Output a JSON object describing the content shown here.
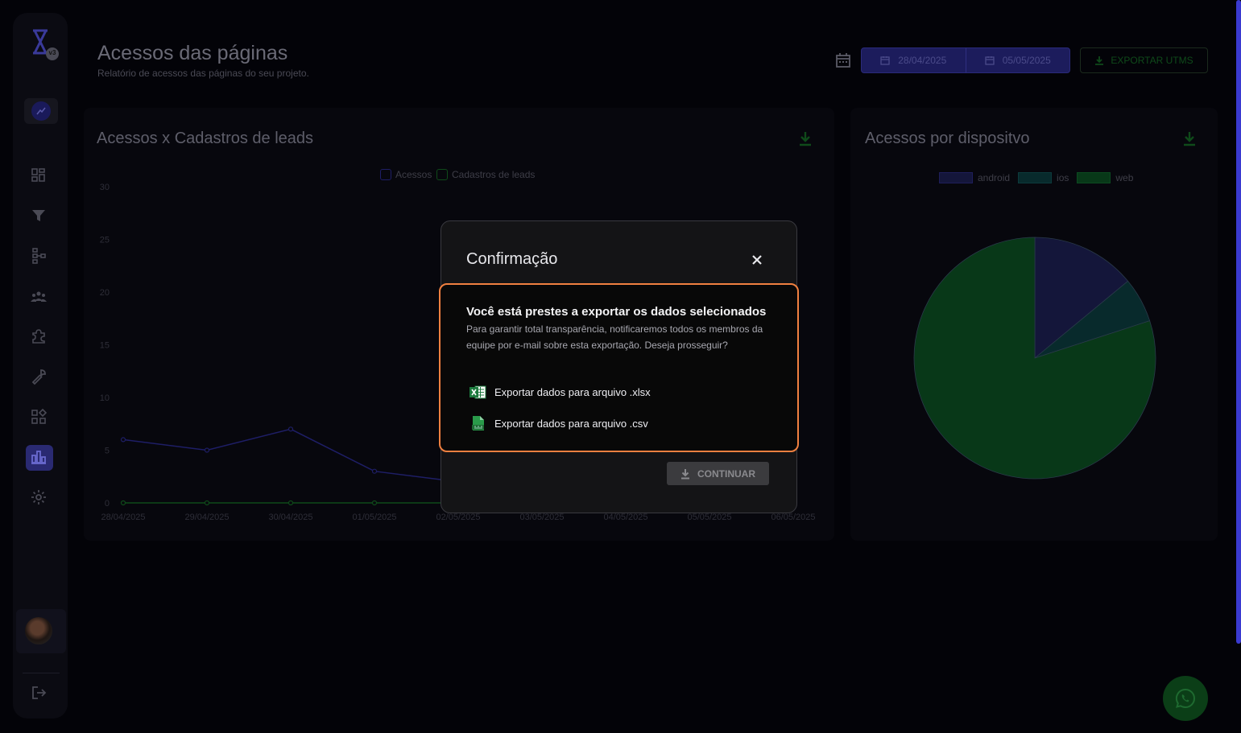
{
  "header": {
    "title": "Acessos das páginas",
    "subtitle": "Relatório de acessos das páginas do seu projeto.",
    "date_start": "28/04/2025",
    "date_end": "05/05/2025",
    "export_utms_label": "EXPORTAR UTMS"
  },
  "sidebar": {
    "brand_badge": "v3",
    "items": [
      "dashboard-icon",
      "funnel-icon",
      "flow-icon",
      "team-icon",
      "puzzle-icon",
      "wrench-icon",
      "apps-icon",
      "chart-icon",
      "gear-icon"
    ],
    "active_item": "chart-icon"
  },
  "colors": {
    "accent": "#2a2a72",
    "highlight_border": "#f08040",
    "acessos_line": "#1e1e66",
    "cadastros_line": "#0f4a1a",
    "android": "#14163a",
    "ios": "#082a2c",
    "web": "#083818"
  },
  "chart_data": [
    {
      "type": "line",
      "title": "Acessos x Cadastros de leads",
      "x": [
        "28/04/2025",
        "29/04/2025",
        "30/04/2025",
        "01/05/2025",
        "02/05/2025",
        "03/05/2025",
        "04/05/2025",
        "05/05/2025",
        "06/05/2025"
      ],
      "series": [
        {
          "name": "Acessos",
          "values": [
            6,
            5,
            7,
            3,
            2,
            2,
            2,
            2,
            2
          ]
        },
        {
          "name": "Cadastros de leads",
          "values": [
            0,
            0,
            0,
            0,
            0,
            0,
            0,
            0,
            0
          ]
        }
      ],
      "yticks": [
        "0",
        "5",
        "10",
        "15",
        "20",
        "25",
        "30"
      ],
      "ylim": [
        0,
        30
      ],
      "legend": "top-center",
      "grid": false
    },
    {
      "type": "pie",
      "title": "Acessos por dispositvo",
      "labels": [
        "android",
        "ios",
        "web"
      ],
      "values": [
        14,
        6,
        80
      ],
      "legend": "top-center"
    }
  ],
  "modal": {
    "title": "Confirmação",
    "heading": "Você está prestes a exportar os dados selecionados",
    "body": "Para garantir total transparência, notificaremos todos os membros da equipe por e-mail sobre esta exportação. Deseja prosseguir?",
    "options": [
      {
        "label": "Exportar dados para arquivo .xlsx",
        "icon": "excel-icon"
      },
      {
        "label": "Exportar dados para arquivo .csv",
        "icon": "csv-file-icon"
      }
    ],
    "continue_label": "CONTINUAR"
  }
}
